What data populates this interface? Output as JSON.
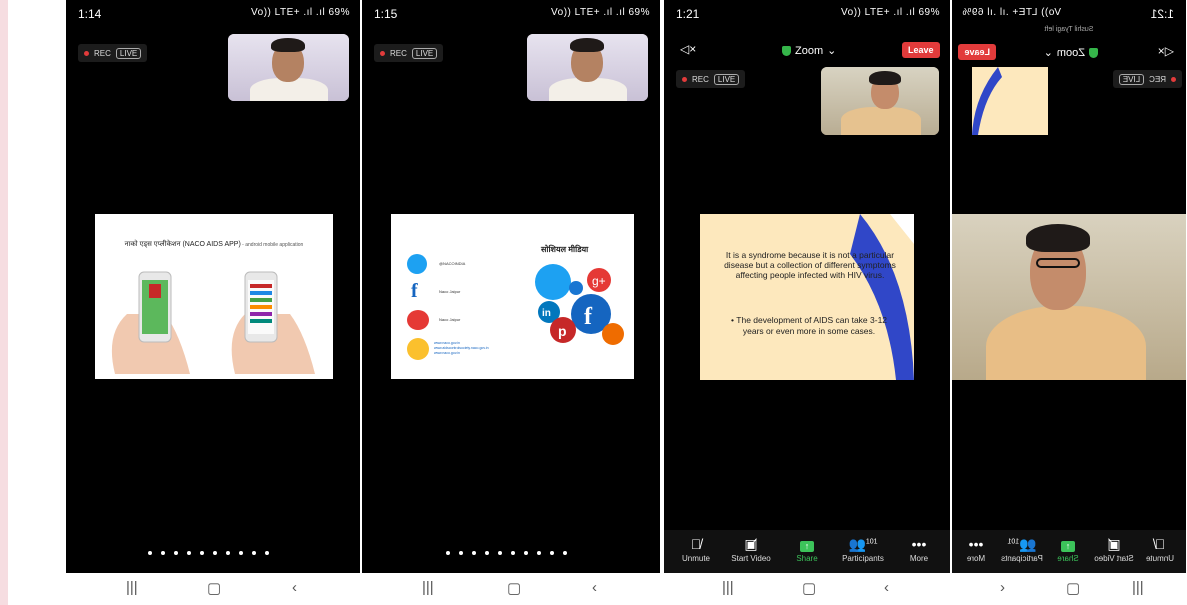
{
  "phones": [
    {
      "time": "1:14",
      "status_icons": "Vo)) LTE+ .ıl .ıl 69%",
      "rec": "REC",
      "live": "LIVE",
      "slide": {
        "title": "नाको एड्स एप्लीकेशन (NACO AIDS APP)",
        "subtitle": " - android mobile application"
      }
    },
    {
      "time": "1:15",
      "status_icons": "Vo)) LTE+ .ıl .ıl 69%",
      "rec": "REC",
      "live": "LIVE",
      "slide": {
        "title": "सोशियल मीडिया",
        "rows": [
          "@NACOINDIA",
          "Naco Jaipur",
          "Naco Jaipur"
        ],
        "links": [
          "www.naco.gov.in",
          "www.aidscontrolsociety.naco.gov.in",
          "www.naco.gov.in"
        ]
      }
    },
    {
      "time": "1:21",
      "status_icons": "Vo)) LTE+ .ıl .ıl 69%",
      "rec": "REC",
      "live": "LIVE",
      "zoom_label": "Zoom",
      "leave_label": "Leave",
      "slide": {
        "para": "It is a syndrome because it is not a particular disease but a collection of different symptoms affecting people infected with HIV virus.",
        "bullet": "The development of AIDS can take 3-12 years or even more in some cases."
      },
      "toolbar": [
        "Unmute",
        "Start Video",
        "Share",
        "Participants",
        "More"
      ],
      "participant_count": "101"
    },
    {
      "time": "1:21",
      "status_icons": "Vo)) LTE+ .ıl .ıl 69%",
      "rec": "REC",
      "live": "LIVE",
      "zoom_label": "Zoom",
      "leave_label": "Leave",
      "notice": "Sushil Tyagi left",
      "toolbar": [
        "Unmute",
        "Start Video",
        "Share",
        "Participants",
        "More"
      ],
      "participant_count": "101"
    }
  ],
  "nav_icons": [
    "recent-apps",
    "home",
    "back"
  ]
}
